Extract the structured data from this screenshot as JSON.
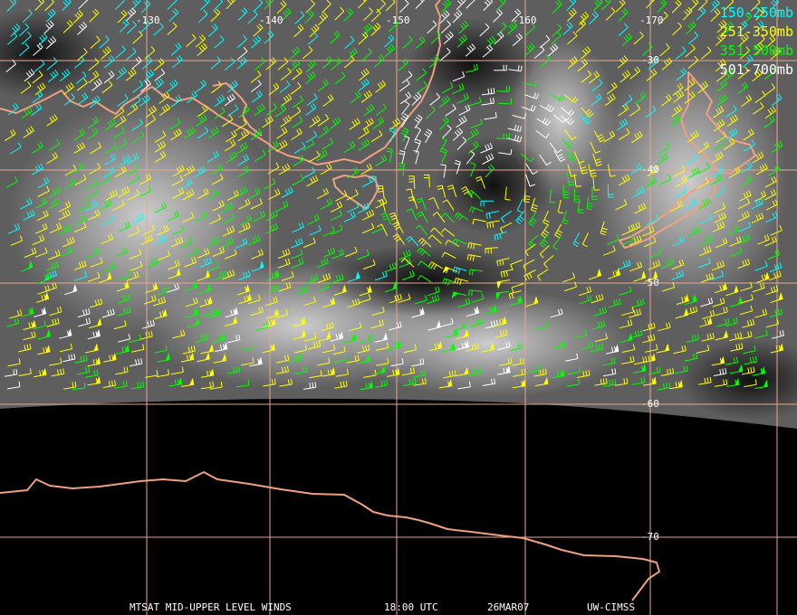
{
  "colors": {
    "grid": "#e8a88c",
    "coast": "#f0a080",
    "ocean_dark": "#111111",
    "cloud_light": "#d8d8d8",
    "space": "#000000",
    "layer_150_250": "#00ffff",
    "layer_251_350": "#ffff00",
    "layer_351_500": "#00ff00",
    "layer_501_700": "#ffffff"
  },
  "legend": {
    "items": [
      {
        "label": "150-250mb",
        "color": "#00ffff"
      },
      {
        "label": "251-350mb",
        "color": "#ffff00"
      },
      {
        "label": "351-500mb",
        "color": "#00ff00"
      },
      {
        "label": "501-700mb",
        "color": "#ffffff"
      }
    ]
  },
  "longitude_labels": [
    "-130",
    "-140",
    "-150",
    "-160",
    "-170"
  ],
  "latitude_labels": [
    "-30",
    "-40",
    "-50",
    "-60",
    "-70"
  ],
  "caption": {
    "product": "MTSAT MID-UPPER LEVEL WINDS",
    "time": "18:00 UTC",
    "date": "26MAR07",
    "source": "UW-CIMSS"
  }
}
